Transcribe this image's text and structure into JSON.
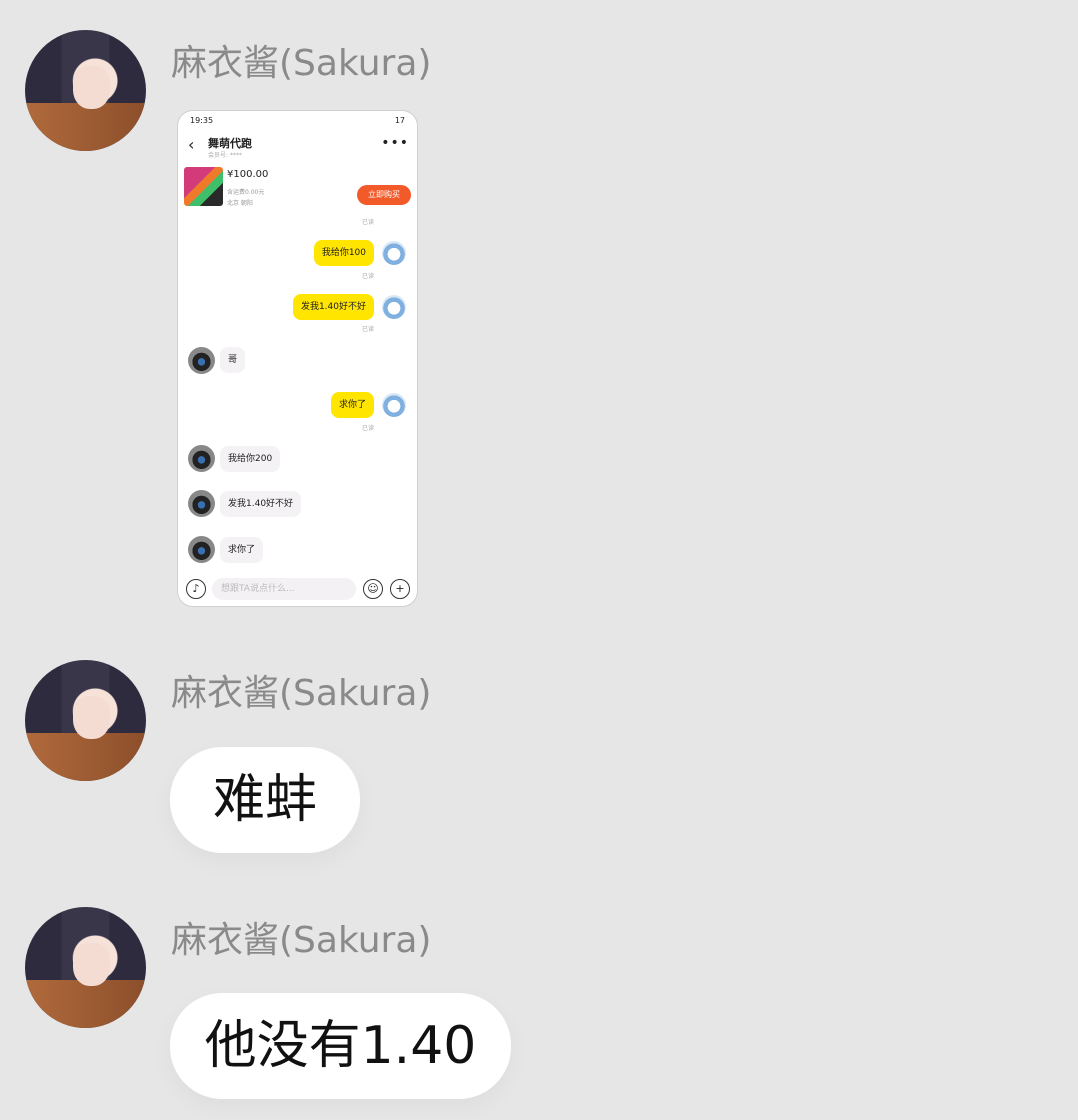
{
  "messages": [
    {
      "sender": "麻衣酱(Sakura)"
    },
    {
      "sender": "麻衣酱(Sakura)",
      "text": "难蚌"
    },
    {
      "sender": "麻衣酱(Sakura)",
      "text": "他没有1.40"
    }
  ],
  "screenshot": {
    "status_time": "19:35",
    "status_right": "17",
    "title": "舞萌代跑",
    "subtitle": "会员号: ****",
    "more_icon": "more-dots-icon",
    "price": "¥100.00",
    "shipping": "含运费0.00元",
    "location": "北京 朝阳",
    "buy_label": "立即购买",
    "read_label": "已读",
    "chat": [
      {
        "from": "me",
        "text": "我给你100"
      },
      {
        "from": "me",
        "text": "发我1.40好不好"
      },
      {
        "from": "other",
        "text": "哥"
      },
      {
        "from": "me",
        "text": "求你了"
      },
      {
        "from": "other",
        "text": "我给你200"
      },
      {
        "from": "other",
        "text": "发我1.40好不好"
      },
      {
        "from": "other",
        "text": "求你了"
      }
    ],
    "input_placeholder": "想跟TA说点什么..."
  },
  "colors": {
    "background": "#e6e6e6",
    "bubble": "#ffffff",
    "sender": "#8a8a8a",
    "accent_yellow": "#ffe500",
    "buy_orange": "#f25a2a"
  }
}
